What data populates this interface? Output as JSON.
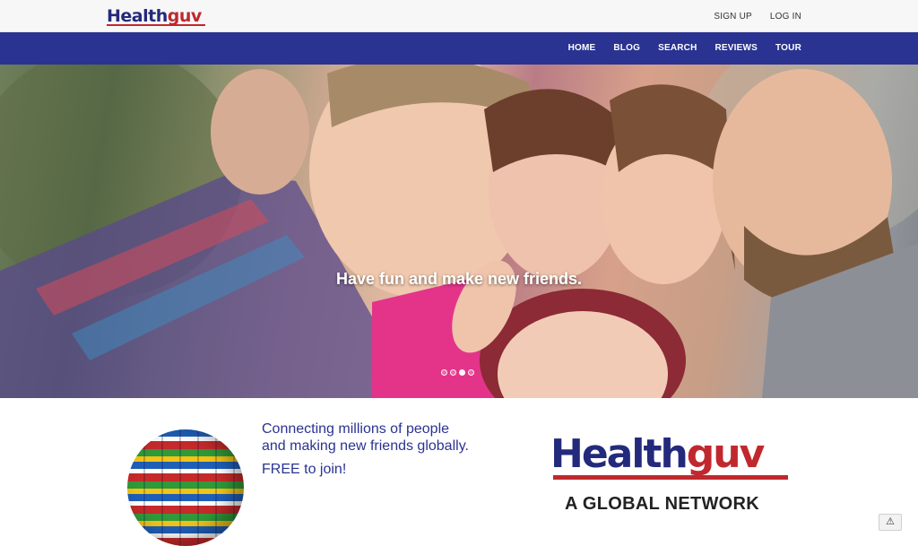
{
  "header": {
    "logo": {
      "part1": "Health",
      "part2": "guv"
    },
    "links": [
      "SIGN UP",
      "LOG IN"
    ]
  },
  "nav": {
    "items": [
      "HOME",
      "BLOG",
      "SEARCH",
      "REVIEWS",
      "TOUR"
    ]
  },
  "hero": {
    "caption": "Have fun and make new friends.",
    "slide_count": 4,
    "active_slide": 3
  },
  "intro": {
    "line1": "Connecting millions of people",
    "line2": "and making new friends globally.",
    "cta": "FREE to join!"
  },
  "brand": {
    "part1": "Health",
    "part2": "guv",
    "subtitle": "A GLOBAL NETWORK"
  },
  "colors": {
    "nav_bg": "#2a3391",
    "brand_blue": "#232a7c",
    "brand_red": "#c0282d"
  },
  "icons": {
    "warning": "⚠"
  }
}
